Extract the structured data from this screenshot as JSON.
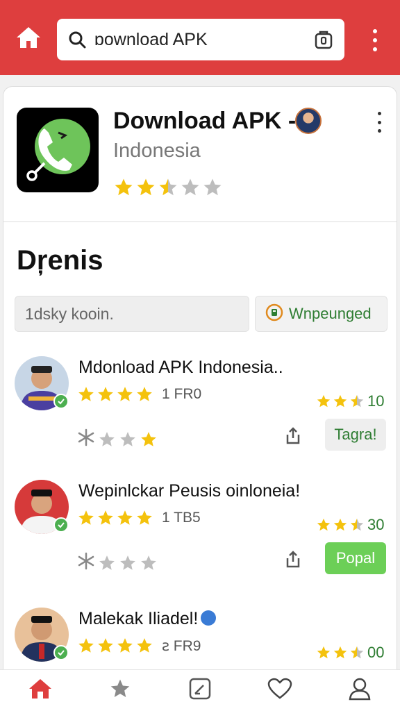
{
  "topbar": {
    "color": "#de3e3e",
    "home_icon": "home-icon",
    "search": {
      "value": "ɒownload APK",
      "icon": "search-icon",
      "camera_icon": "camera-icon"
    },
    "menu_icon": "more-vert-icon"
  },
  "app": {
    "title": "Download APK -",
    "subtitle": "Indonesia",
    "rating": 2.5,
    "icon": "phone-app-icon",
    "menu_icon": "more-vert-icon"
  },
  "section": {
    "title": "Dŗenis"
  },
  "filter": {
    "input_value": "1dsky kooin.",
    "button_label": "Wnpeunged",
    "button_icon": "badge-icon"
  },
  "items": [
    {
      "title": "Mdonload APK Indonesia..",
      "stars": 4,
      "count": "1 FR0",
      "score": "10",
      "score_stars": 2.5,
      "mini_stars": 3,
      "button": "Tagra!",
      "button_style": "grey",
      "verified": false
    },
    {
      "title": "Wepinlckar Peusis oinloneia!",
      "stars": 4,
      "count": "1 TB5",
      "score": "30",
      "score_stars": 2.5,
      "mini_stars": 3,
      "button": "Popal",
      "button_style": "green",
      "verified": false
    },
    {
      "title": "Malekak Iliadel!",
      "stars": 4,
      "count": "ꙅ FR9",
      "score": "00",
      "score_stars": 2.5,
      "mini_stars": 3,
      "button": "",
      "button_style": "none",
      "verified": true
    }
  ],
  "colors": {
    "star": "#f4c20d",
    "star_empty": "#bdbdbd",
    "accent_green": "#2e7d32",
    "home_active": "#de3e3e"
  },
  "bottom_nav": [
    {
      "icon": "home-icon",
      "active": true
    },
    {
      "icon": "star-icon",
      "active": false
    },
    {
      "icon": "edit-icon",
      "active": false
    },
    {
      "icon": "heart-icon",
      "active": false
    },
    {
      "icon": "profile-icon",
      "active": false
    }
  ]
}
